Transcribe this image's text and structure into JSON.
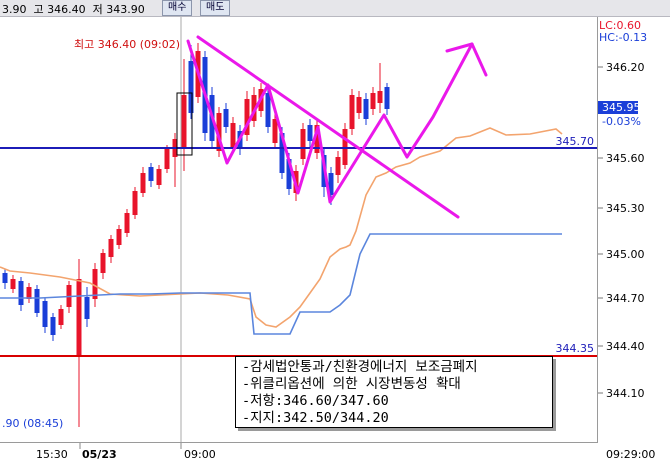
{
  "topbar": {
    "current": "3.90",
    "high_label": "고",
    "high": "346.40",
    "low_label": "저",
    "low": "343.90",
    "buy_label": "매수",
    "sell_label": "매도"
  },
  "annotations": {
    "high_mark": "최고 346.40 (09:02)",
    "low_mark": ".90 (08:45)"
  },
  "levels": {
    "upper": "345.70",
    "lower": "344.35"
  },
  "axis": {
    "lc": "LC:0.60",
    "hc": "HC:-0.13",
    "ticks": [
      "346.20",
      "345.60",
      "345.30",
      "345.00",
      "344.70",
      "344.40",
      "344.10"
    ],
    "price_box": "345.95",
    "change": "-0.03%"
  },
  "xaxis": {
    "labels": [
      "15:30",
      "05/23",
      "09:00"
    ],
    "time": "09:29:00"
  },
  "note": {
    "line1": "-감세법안통과/친환경에너지 보조금폐지",
    "line2": "-위클리옵션에 의한 시장변동성 확대",
    "line3": "-저항:346.60/347.60",
    "line4": "-지지:342.50/344.20"
  },
  "colors": {
    "up": "#e8142b",
    "down": "#1a3ed8",
    "upper_line": "#1c1cb8",
    "lower_line": "#d80000",
    "drawing": "#ea18ea",
    "orange_line": "#f3a46e",
    "blue_line": "#5b86dd"
  }
}
